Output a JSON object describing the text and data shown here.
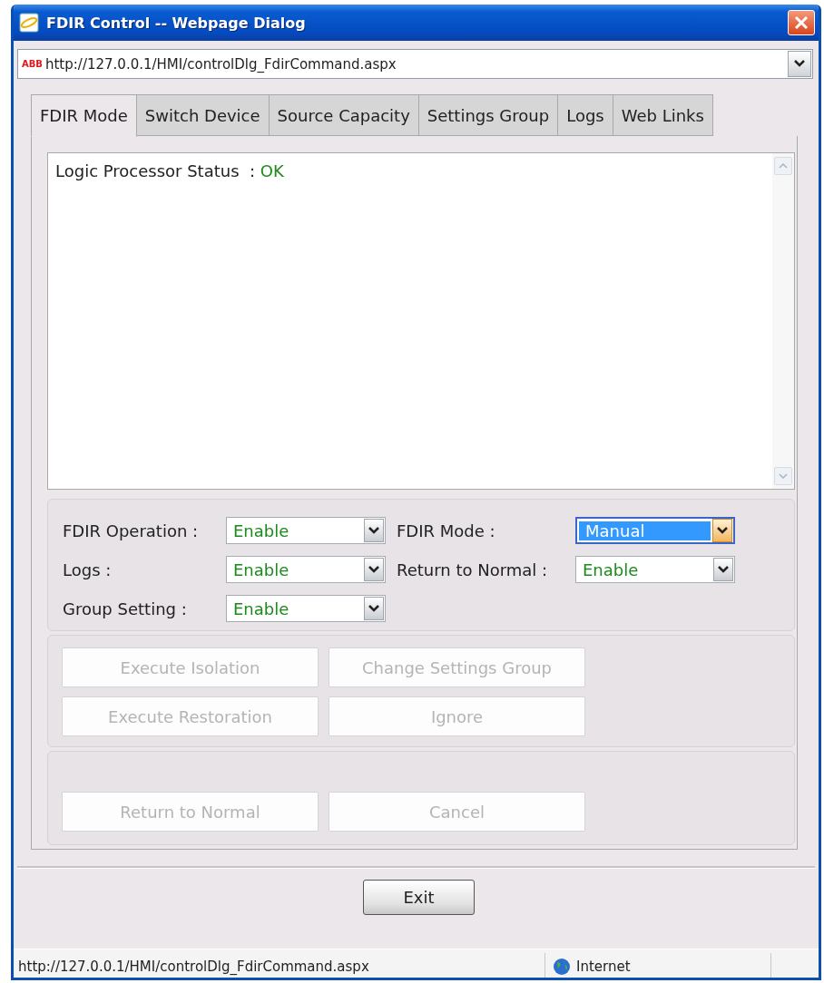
{
  "window": {
    "title": "FDIR Control -- Webpage Dialog"
  },
  "address_bar": {
    "logo": "ABB",
    "url": "http://127.0.0.1/HMI/controlDlg_FdirCommand.aspx"
  },
  "tabs": [
    {
      "label": "FDIR Mode",
      "selected": true
    },
    {
      "label": "Switch Device",
      "selected": false
    },
    {
      "label": "Source Capacity",
      "selected": false
    },
    {
      "label": "Settings Group",
      "selected": false
    },
    {
      "label": "Logs",
      "selected": false
    },
    {
      "label": "Web Links",
      "selected": false
    }
  ],
  "status": {
    "label": "Logic Processor Status  :",
    "value": "OK"
  },
  "settings": [
    {
      "label": "FDIR Operation :",
      "value": "Enable",
      "focused": false
    },
    {
      "label": "FDIR Mode :",
      "value": "Manual",
      "focused": true
    },
    {
      "label": "Logs :",
      "value": "Enable",
      "focused": false
    },
    {
      "label": "Return to Normal :",
      "value": "Enable",
      "focused": false
    },
    {
      "label": "Group Setting :",
      "value": "Enable",
      "focused": false
    }
  ],
  "actions": [
    {
      "label": "Execute Isolation",
      "disabled": true
    },
    {
      "label": "Change Settings Group",
      "disabled": true
    },
    {
      "label": "Execute Restoration",
      "disabled": true
    },
    {
      "label": "Ignore",
      "disabled": true
    }
  ],
  "bottom_actions": [
    {
      "label": "Return to Normal",
      "disabled": true
    },
    {
      "label": "Cancel",
      "disabled": true
    }
  ],
  "exit_button": {
    "label": "Exit"
  },
  "status_bar": {
    "url": "http://127.0.0.1/HMI/controlDlg_FdirCommand.aspx",
    "zone": "Internet"
  }
}
